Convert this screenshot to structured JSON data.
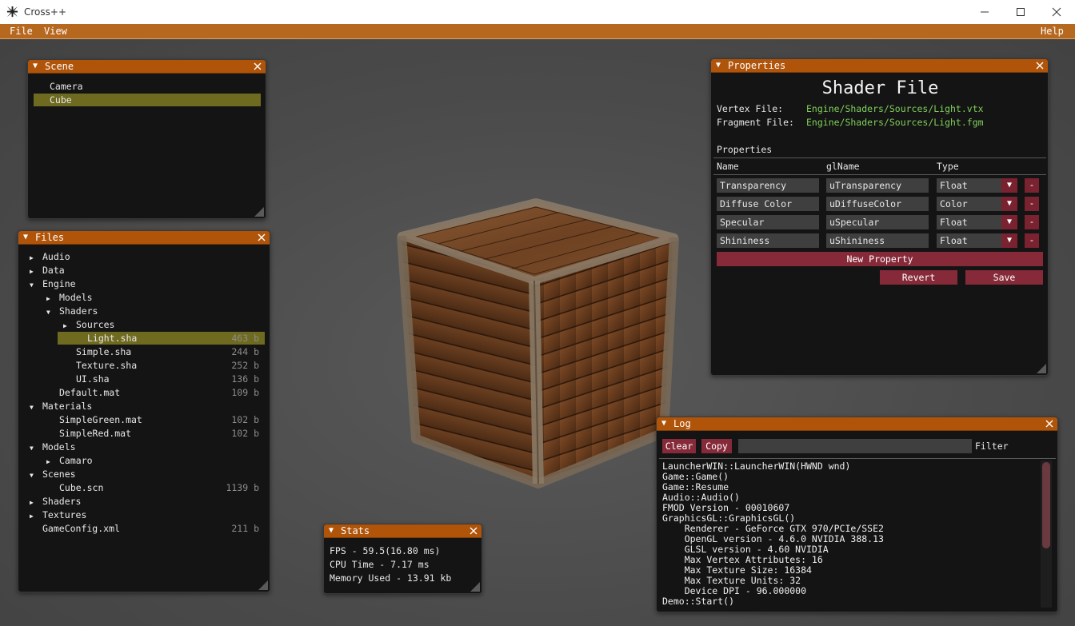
{
  "window": {
    "title": "Cross++",
    "icon": "cross-pattee-icon"
  },
  "menu": {
    "file": "File",
    "view": "View",
    "help": "Help"
  },
  "scene_panel": {
    "title": "Scene",
    "items": [
      {
        "label": "Camera",
        "selected": false
      },
      {
        "label": "Cube",
        "selected": true
      }
    ]
  },
  "files_panel": {
    "title": "Files",
    "items": [
      {
        "label": "Audio",
        "arrow": "▶",
        "size": ""
      },
      {
        "label": "Data",
        "arrow": "▶",
        "size": ""
      },
      {
        "label": "Engine",
        "arrow": "▼",
        "size": ""
      },
      {
        "label": "Models",
        "arrow": "▶",
        "size": ""
      },
      {
        "label": "Shaders",
        "arrow": "▼",
        "size": ""
      },
      {
        "label": "Sources",
        "arrow": "▶",
        "size": ""
      },
      {
        "label": "Light.sha",
        "arrow": "",
        "size": "463 b"
      },
      {
        "label": "Simple.sha",
        "arrow": "",
        "size": "244 b"
      },
      {
        "label": "Texture.sha",
        "arrow": "",
        "size": "252 b"
      },
      {
        "label": "UI.sha",
        "arrow": "",
        "size": "136 b"
      },
      {
        "label": "Default.mat",
        "arrow": "",
        "size": "109 b"
      },
      {
        "label": "Materials",
        "arrow": "▼",
        "size": ""
      },
      {
        "label": "SimpleGreen.mat",
        "arrow": "",
        "size": "102 b"
      },
      {
        "label": "SimpleRed.mat",
        "arrow": "",
        "size": "102 b"
      },
      {
        "label": "Models",
        "arrow": "▼",
        "size": ""
      },
      {
        "label": "Camaro",
        "arrow": "▶",
        "size": ""
      },
      {
        "label": "Scenes",
        "arrow": "▼",
        "size": ""
      },
      {
        "label": "Cube.scn",
        "arrow": "",
        "size": "1139 b"
      },
      {
        "label": "Shaders",
        "arrow": "▶",
        "size": ""
      },
      {
        "label": "Textures",
        "arrow": "▶",
        "size": ""
      },
      {
        "label": "GameConfig.xml",
        "arrow": "",
        "size": "211 b"
      }
    ]
  },
  "stats_panel": {
    "title": "Stats",
    "fps": "FPS - 59.5(16.80 ms)",
    "cpu": "CPU Time - 7.17 ms",
    "memory": "Memory Used - 13.91 kb"
  },
  "properties_panel": {
    "title": "Properties",
    "heading": "Shader File",
    "vertex_label": "Vertex File:",
    "vertex_value": "Engine/Shaders/Sources/Light.vtx",
    "fragment_label": "Fragment File:",
    "fragment_value": "Engine/Shaders/Sources/Light.fgm",
    "section": "Properties",
    "columns": [
      "Name",
      "glName",
      "Type"
    ],
    "rows": [
      {
        "name": "Transparency",
        "glname": "uTransparency",
        "type": "Float"
      },
      {
        "name": "Diffuse Color",
        "glname": "uDiffuseColor",
        "type": "Color"
      },
      {
        "name": "Specular",
        "glname": "uSpecular",
        "type": "Float"
      },
      {
        "name": "Shininess",
        "glname": "uShininess",
        "type": "Float"
      }
    ],
    "remove_label": "-",
    "new_property": "New Property",
    "revert": "Revert",
    "save": "Save"
  },
  "log_panel": {
    "title": "Log",
    "clear": "Clear",
    "copy": "Copy",
    "filter_value": "",
    "filter_label": "Filter",
    "lines": [
      "LauncherWIN::LauncherWIN(HWND wnd)",
      "Game::Game()",
      "Game::Resume",
      "Audio::Audio()",
      "FMOD Version - 00010607",
      "GraphicsGL::GraphicsGL()",
      "    Renderer - GeForce GTX 970/PCIe/SSE2",
      "    OpenGL version - 4.6.0 NVIDIA 388.13",
      "    GLSL version - 4.60 NVIDIA",
      "    Max Vertex Attributes: 16",
      "    Max Texture Size: 16384",
      "    Max Texture Units: 32",
      "    Device DPI - 96.000000",
      "Demo::Start()"
    ]
  },
  "colors": {
    "accent": "#b0540a",
    "selection": "#6e6a1f",
    "button": "#862a3a",
    "path_green": "#7fd05a"
  }
}
